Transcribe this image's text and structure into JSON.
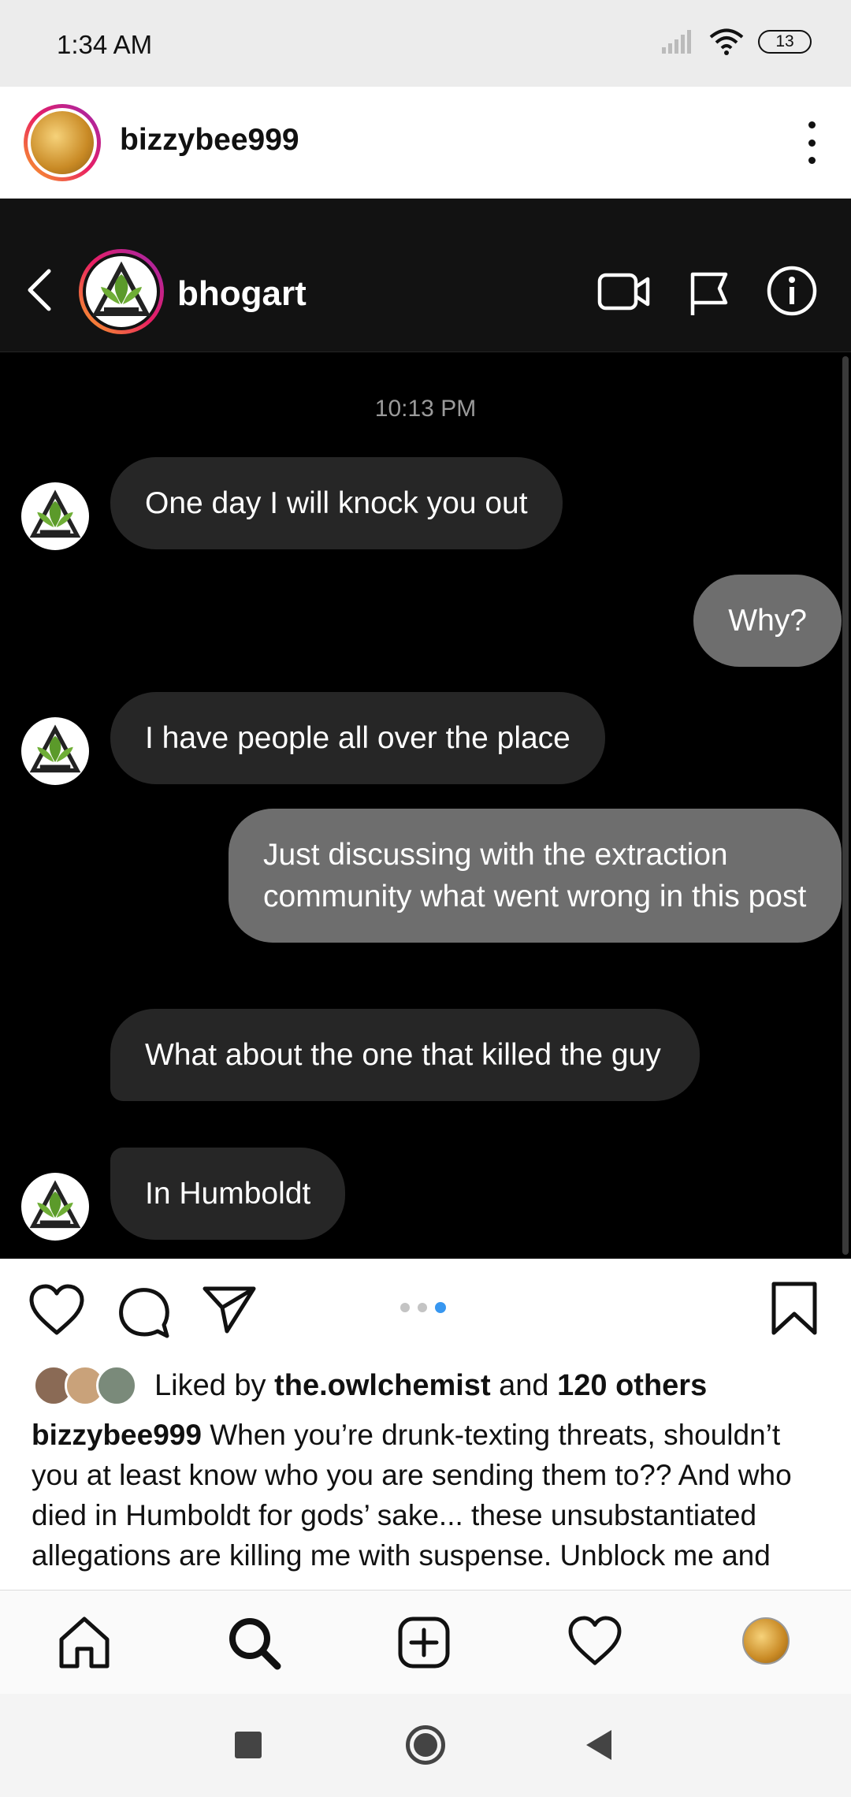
{
  "status_bar": {
    "time": "1:34 AM",
    "battery": "13"
  },
  "post": {
    "username": "bizzybee999"
  },
  "dm": {
    "contact_name": "bhogart",
    "timestamp": "10:13 PM",
    "messages": [
      {
        "from": "them",
        "text": "One day I will knock you out"
      },
      {
        "from": "me",
        "text": "Why?"
      },
      {
        "from": "them",
        "text": "I have people all over the place"
      },
      {
        "from": "me",
        "text": "Just discussing with the extraction community what went wrong in this post"
      },
      {
        "from": "them",
        "text": "What about the one that killed the guy"
      },
      {
        "from": "them",
        "text": "In Humboldt"
      }
    ]
  },
  "likes": {
    "prefix": "Liked by ",
    "user": "the.owlchemist",
    "middle": " and ",
    "others": "120 others"
  },
  "caption": {
    "username": "bizzybee999",
    "text": " When you’re drunk-texting threats, shouldn’t you at least know who you are sending them to?? And who died in Humboldt for gods’ sake... these unsubstantiated allegations are killing me with suspense. Unblock me and"
  },
  "icons": [
    "back-icon",
    "video-call-icon",
    "flag-icon",
    "info-icon",
    "heart-icon",
    "comment-icon",
    "share-icon",
    "bookmark-icon",
    "home-icon",
    "search-icon",
    "add-post-icon",
    "activity-icon",
    "profile-icon"
  ],
  "colors": {
    "accent_blue": "#3897f0",
    "sent_bubble": "#6e6e6e",
    "received_bubble": "#262626"
  }
}
